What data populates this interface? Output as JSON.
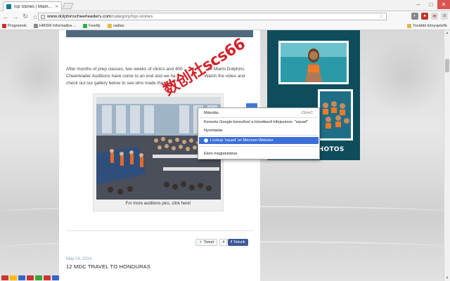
{
  "browser": {
    "tab_title": "Top Stories | Miami Dolphi",
    "url_host": "www.dolphinscheerleaders.com",
    "url_path": "/category/top-stories",
    "bookmarks": [
      {
        "label": "Programok"
      },
      {
        "label": "HMSW Informatika ..."
      },
      {
        "label": "Feedly"
      },
      {
        "label": "vadias"
      }
    ],
    "bookmarks_right": "További könyvjelzők"
  },
  "article": {
    "text_line1": "After months of prep classes, two weeks of clinics and 400",
    "text_line1b": "14 Miami Dolphins",
    "text_line2a": "Cheerleader Auditions have come to an end and we ha",
    "text_line2b": "Watch the video and",
    "text_line3": "check out our gallery below to see who made the cut!",
    "photo_caption": "For more auditions pics, click here!"
  },
  "share": {
    "tweet_label": "Tweet",
    "tweet_count": "4",
    "facebook_label": "Tetszik"
  },
  "post": {
    "date": "May 19, 2014",
    "title": "12 MDC TRAVEL TO HONDURAS"
  },
  "sidebar": {
    "more_photos": "MORE PHOTOS",
    "more_arrows": "»"
  },
  "context_menu": {
    "items": [
      {
        "label": "Másolás",
        "shortcut": "Ctrl+C"
      },
      {
        "label": "Keresés Google-keresővel a következő kifejezésre: \"squad\"",
        "shortcut": ""
      },
      {
        "label": "Nyomtatás",
        "shortcut": ""
      },
      {
        "label": "Lookup 'squad' on Merriam-Webster",
        "shortcut": ""
      },
      {
        "label": "Elem megtekintése",
        "shortcut": ""
      }
    ]
  },
  "watermark": "数创社scs66",
  "colors": {
    "widget_bg": "#0f4d5c",
    "accent_teal": "#00b3c6",
    "menu_highlight": "#3d6fd9",
    "facebook_blue": "#3b5998"
  }
}
